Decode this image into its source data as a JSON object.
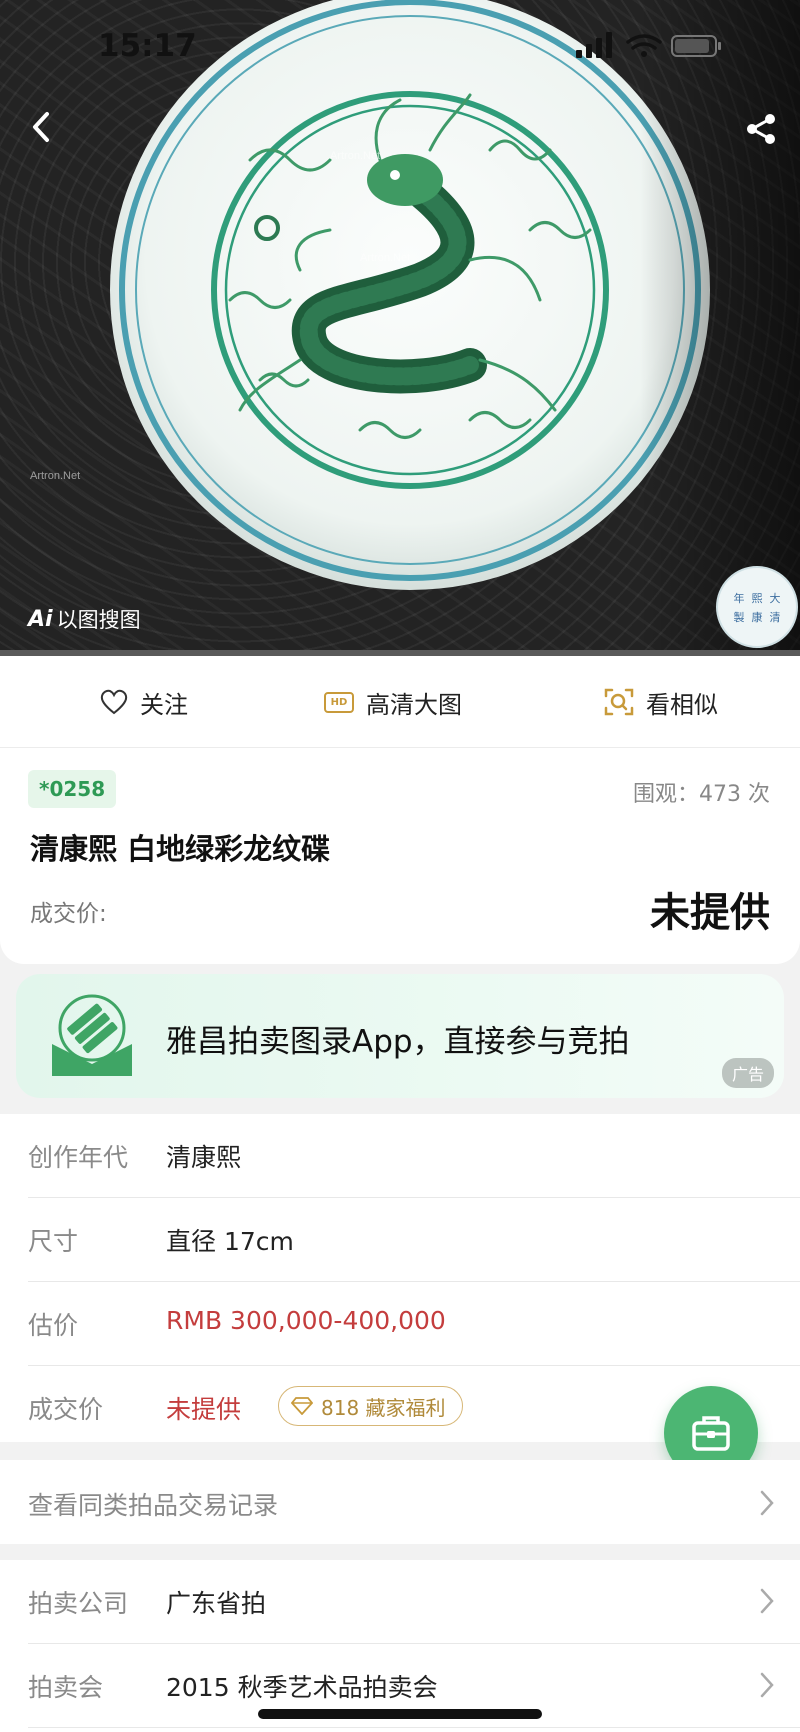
{
  "status_bar": {
    "time": "15:17"
  },
  "hero": {
    "watermark": "Artron.Net",
    "ai_search": {
      "badge": "Ai",
      "label": "以图搜图"
    },
    "seal_chars": [
      "年",
      "熙",
      "大",
      "製",
      "康",
      "清"
    ]
  },
  "actions": {
    "follow": "关注",
    "hd_badge": "HD",
    "hd": "高清大图",
    "similar": "看相似"
  },
  "lot": {
    "number": "*0258",
    "views": "围观：473 次",
    "title": "清康熙 白地绿彩龙纹碟",
    "price_label": "成交价:",
    "price_value": "未提供"
  },
  "ad": {
    "text": "雅昌拍卖图录App，直接参与竞拍",
    "tag": "广告"
  },
  "details": {
    "era_label": "创作年代",
    "era_value": "清康熙",
    "size_label": "尺寸",
    "size_value": "直径 17cm",
    "estimate_label": "估价",
    "estimate_value": "RMB  300,000-400,000",
    "deal_label": "成交价",
    "deal_value": "未提供",
    "perk": "818 藏家福利"
  },
  "similar_records": "查看同类拍品交易记录",
  "company": {
    "house_label": "拍卖公司",
    "house_value": "广东省拍",
    "sale_label": "拍卖会",
    "sale_value": "2015 秋季艺术品拍卖会"
  },
  "colors": {
    "brand_green": "#4cb673",
    "accent_red": "#c43d3d",
    "gold": "#b08a3a"
  }
}
